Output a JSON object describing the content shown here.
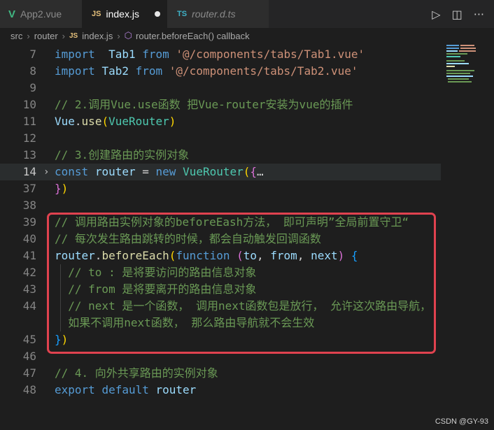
{
  "tabs": [
    {
      "label": "App2.vue",
      "icon": "vue-icon",
      "icon_text": "V"
    },
    {
      "label": "index.js",
      "icon": "js-icon",
      "icon_text": "JS"
    },
    {
      "label": "router.d.ts",
      "icon": "ts-icon",
      "icon_text": "TS"
    }
  ],
  "actions": {
    "run": "▷",
    "split": "◫",
    "more": "···"
  },
  "breadcrumb": {
    "items": [
      "src",
      "router",
      "index.js",
      "router.beforeEach() callback"
    ],
    "sep": "›",
    "js_icon_text": "JS",
    "cube_icon_text": "⬡"
  },
  "editor": {
    "lines": [
      {
        "n": "7",
        "tokens": [
          [
            "kw",
            "import"
          ],
          [
            "",
            "  "
          ],
          [
            "var",
            "Tab1"
          ],
          [
            "",
            " "
          ],
          [
            "kw",
            "from"
          ],
          [
            "",
            " "
          ],
          [
            "str",
            "'@/components/tabs/Tab1.vue'"
          ]
        ]
      },
      {
        "n": "8",
        "tokens": [
          [
            "kw",
            "import"
          ],
          [
            "",
            " "
          ],
          [
            "var",
            "Tab2"
          ],
          [
            "",
            " "
          ],
          [
            "kw",
            "from"
          ],
          [
            "",
            " "
          ],
          [
            "str",
            "'@/components/tabs/Tab2.vue'"
          ]
        ]
      },
      {
        "n": "9",
        "tokens": []
      },
      {
        "n": "10",
        "tokens": [
          [
            "cm",
            "// 2.调用Vue.use函数 把Vue-router安装为vue的插件"
          ]
        ]
      },
      {
        "n": "11",
        "tokens": [
          [
            "var",
            "Vue"
          ],
          [
            "",
            "."
          ],
          [
            "fn",
            "use"
          ],
          [
            "p1",
            "("
          ],
          [
            "cls",
            "VueRouter"
          ],
          [
            "p1",
            ")"
          ]
        ]
      },
      {
        "n": "12",
        "tokens": []
      },
      {
        "n": "13",
        "tokens": [
          [
            "cm",
            "// 3.创建路由的实例对象"
          ]
        ]
      },
      {
        "n": "14",
        "tokens": [
          [
            "kw",
            "const"
          ],
          [
            "",
            " "
          ],
          [
            "var",
            "router"
          ],
          [
            "",
            " = "
          ],
          [
            "kw",
            "new"
          ],
          [
            "",
            " "
          ],
          [
            "cls",
            "VueRouter"
          ],
          [
            "p1",
            "("
          ],
          [
            "p2",
            "{"
          ],
          [
            "",
            "…"
          ]
        ]
      },
      {
        "n": "37",
        "tokens": [
          [
            "p2",
            "}"
          ],
          [
            "p1",
            ")"
          ]
        ]
      },
      {
        "n": "38",
        "tokens": []
      },
      {
        "n": "39",
        "tokens": [
          [
            "cm",
            "// 调用路由实例对象的beforeEash方法， 即可声明”全局前置守卫“"
          ]
        ]
      },
      {
        "n": "40",
        "tokens": [
          [
            "cm",
            "// 每次发生路由跳转的时候，都会自动触发回调函数"
          ]
        ]
      },
      {
        "n": "41",
        "tokens": [
          [
            "var",
            "router"
          ],
          [
            "",
            "."
          ],
          [
            "fn",
            "beforeEach"
          ],
          [
            "p1",
            "("
          ],
          [
            "kw",
            "function"
          ],
          [
            "",
            " "
          ],
          [
            "p2",
            "("
          ],
          [
            "var",
            "to"
          ],
          [
            "",
            ", "
          ],
          [
            "var",
            "from"
          ],
          [
            "",
            ", "
          ],
          [
            "var",
            "next"
          ],
          [
            "p2",
            ")"
          ],
          [
            "",
            " "
          ],
          [
            "p3",
            "{"
          ]
        ]
      },
      {
        "n": "42",
        "tokens": [
          [
            "",
            "  "
          ],
          [
            "cm",
            "// to : 是将要访问的路由信息对象"
          ]
        ]
      },
      {
        "n": "43",
        "tokens": [
          [
            "",
            "  "
          ],
          [
            "cm",
            "// from 是将要离开的路由信息对象"
          ]
        ]
      },
      {
        "n": "44",
        "tokens": [
          [
            "",
            "  "
          ],
          [
            "cm",
            "// next 是一个函数， 调用next函数包是放行， 允许这次路由导航，"
          ]
        ]
      },
      {
        "n": "",
        "tokens": [
          [
            "",
            "  "
          ],
          [
            "cm",
            "如果不调用next函数， 那么路由导航就不会生效"
          ]
        ]
      },
      {
        "n": "45",
        "tokens": [
          [
            "p3",
            "}"
          ],
          [
            "p1",
            ")"
          ]
        ]
      },
      {
        "n": "46",
        "tokens": []
      },
      {
        "n": "47",
        "tokens": [
          [
            "cm",
            "// 4. 向外共享路由的实例对象"
          ]
        ]
      },
      {
        "n": "48",
        "tokens": [
          [
            "kw",
            "export"
          ],
          [
            "",
            " "
          ],
          [
            "kw",
            "default"
          ],
          [
            "",
            " "
          ],
          [
            "var",
            "router"
          ]
        ]
      }
    ],
    "fold_marker": "›"
  },
  "watermark": "CSDN @GY-93"
}
